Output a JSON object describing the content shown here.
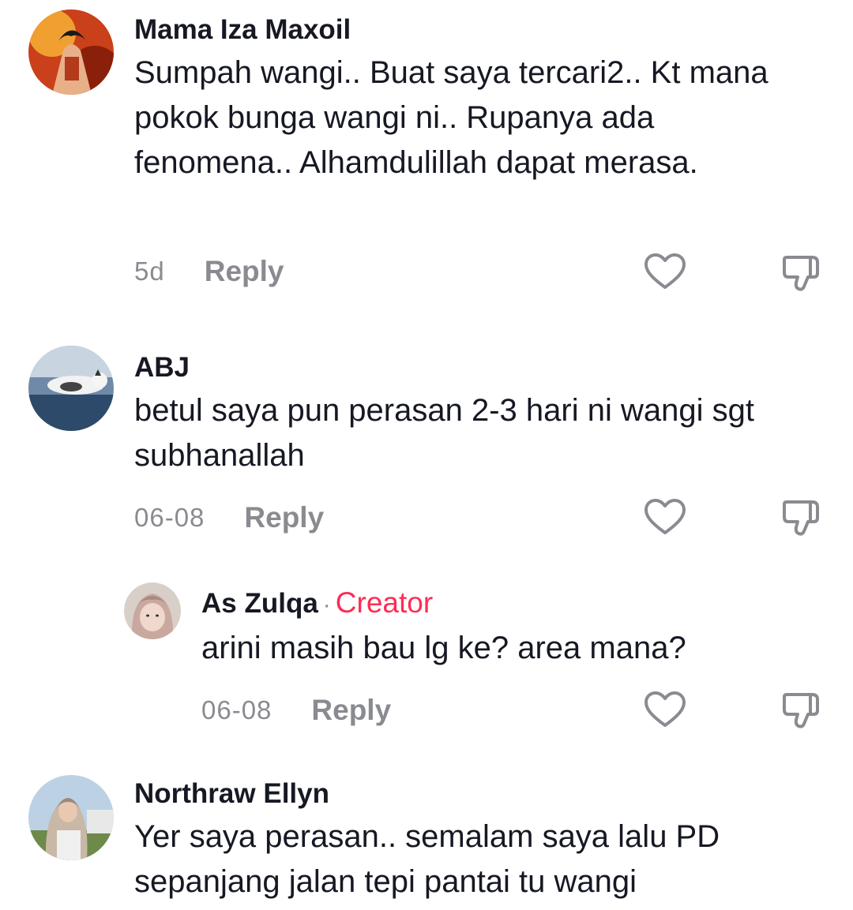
{
  "comments": [
    {
      "username": "Mama Iza Maxoil",
      "text": "Sumpah wangi.. Buat saya tercari2.. Kt mana pokok bunga wangi ni.. Rupanya ada fenomena.. Alhamdulillah dapat merasa.",
      "time": "5d",
      "reply_label": "Reply",
      "like_icon": "heart-outline-icon",
      "dislike_icon": "thumbs-down-icon"
    },
    {
      "username": "ABJ",
      "text": "betul saya pun perasan 2-3 hari ni wangi sgt subhanallah",
      "time": "06-08",
      "reply_label": "Reply",
      "like_icon": "heart-outline-icon",
      "dislike_icon": "thumbs-down-icon",
      "replies": [
        {
          "username": "As Zulqa",
          "separator": "·",
          "badge": "Creator",
          "text": "arini masih bau lg ke? area mana?",
          "time": "06-08",
          "reply_label": "Reply",
          "like_icon": "heart-outline-icon",
          "dislike_icon": "thumbs-down-icon"
        }
      ]
    },
    {
      "username": "Northraw Ellyn",
      "text": "Yer saya perasan.. semalam saya lalu PD sepanjang jalan tepi pantai tu wangi"
    }
  ],
  "colors": {
    "text": "#161823",
    "muted": "#8a8b91",
    "creator_badge": "#fe2c55"
  }
}
